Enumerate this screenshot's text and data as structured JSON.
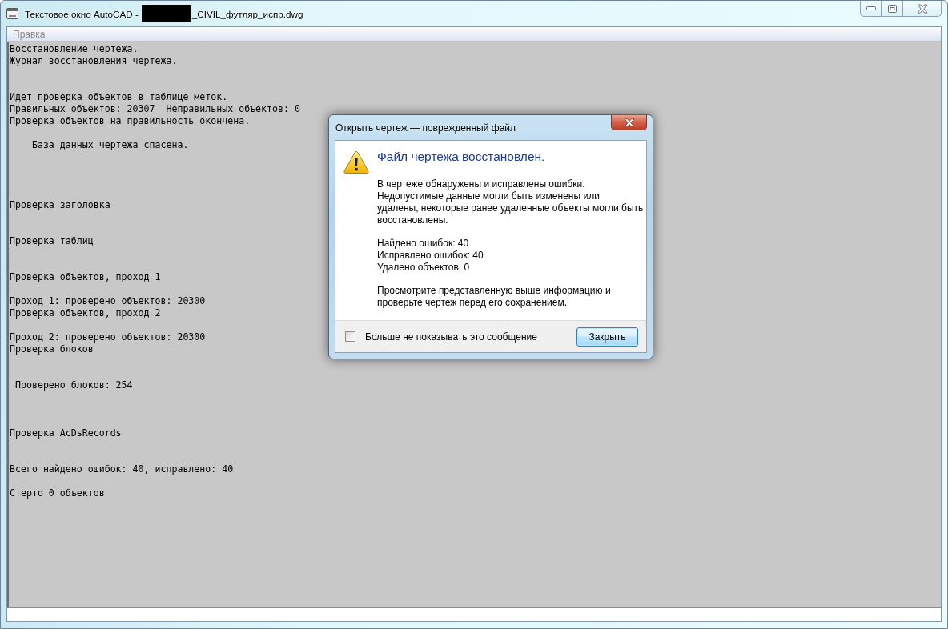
{
  "window": {
    "title": [
      {
        "kind": "text",
        "text": "Текстовое окно AutoCAD -"
      },
      {
        "kind": "redacted"
      },
      {
        "kind": "text",
        "text": "_CIVIL_футляр_испр.dwg"
      }
    ],
    "controls": [
      {
        "kind": "minimize"
      },
      {
        "kind": "maximize"
      },
      {
        "kind": "close"
      }
    ]
  },
  "menu": [
    {
      "label": "Правка",
      "disabled": true
    }
  ],
  "log": {
    "lines": [
      {
        "kind": "text",
        "text": "Восстановление чертежа."
      },
      {
        "kind": "text",
        "text": "Журнал восстановления чертежа."
      },
      {
        "kind": "blank"
      },
      {
        "kind": "blank"
      },
      {
        "kind": "text",
        "text": "Идет проверка объектов в таблице меток."
      },
      {
        "kind": "text",
        "text": "Правильных объектов: 20307  Неправильных объектов: 0"
      },
      {
        "kind": "text",
        "text": "Проверка объектов на правильность окончена."
      },
      {
        "kind": "blank"
      },
      {
        "kind": "text",
        "text": "    База данных чертежа спасена."
      },
      {
        "kind": "blank"
      },
      {
        "kind": "blank"
      },
      {
        "kind": "blank"
      },
      {
        "kind": "blank"
      },
      {
        "kind": "text",
        "text": "Проверка заголовка"
      },
      {
        "kind": "blank"
      },
      {
        "kind": "blank"
      },
      {
        "kind": "text",
        "text": "Проверка таблиц"
      },
      {
        "kind": "blank"
      },
      {
        "kind": "blank"
      },
      {
        "kind": "text",
        "text": "Проверка объектов, проход 1"
      },
      {
        "kind": "blank"
      },
      {
        "kind": "text",
        "text": "Проход 1: проверено объектов: 20300"
      },
      {
        "kind": "text",
        "text": "Проверка объектов, проход 2"
      },
      {
        "kind": "blank"
      },
      {
        "kind": "text",
        "text": "Проход 2: проверено объектов: 20300"
      },
      {
        "kind": "text",
        "text": "Проверка блоков"
      },
      {
        "kind": "blank"
      },
      {
        "kind": "blank"
      },
      {
        "kind": "text",
        "text": " Проверено блоков: 254"
      },
      {
        "kind": "blank"
      },
      {
        "kind": "blank"
      },
      {
        "kind": "blank"
      },
      {
        "kind": "text",
        "text": "Проверка AcDsRecords"
      },
      {
        "kind": "blank"
      },
      {
        "kind": "blank"
      },
      {
        "kind": "text",
        "text": "Всего найдено ошибок: 40, исправлено: 40"
      },
      {
        "kind": "blank"
      },
      {
        "kind": "text",
        "text": "Стерто 0 объектов"
      }
    ]
  },
  "dialog": {
    "title": "Открыть чертеж — поврежденный файл",
    "controls": [
      {
        "kind": "close"
      }
    ],
    "heading": "Файл чертежа восстановлен.",
    "paragraphs": [
      [
        "В чертеже обнаружены и исправлены ошибки.",
        "Недопустимые данные могли быть изменены или",
        "удалены, некоторые ранее удаленные объекты могли быть",
        "восстановлены."
      ],
      [
        "Найдено ошибок: 40",
        "Исправлено ошибок: 40",
        "Удалено объектов: 0"
      ],
      [
        "Просмотрите представленную выше информацию и",
        "проверьте чертеж перед его сохранением."
      ]
    ],
    "checkbox": {
      "label": "Больше не показывать это сообщение",
      "checked": false
    },
    "buttons": [
      {
        "label": "Закрыть",
        "default": true
      }
    ]
  }
}
